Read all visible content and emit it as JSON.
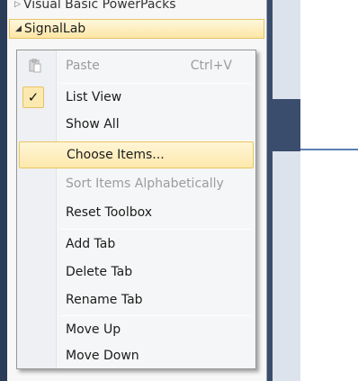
{
  "toolbox": {
    "top_item": "Visual Basic PowerPacks",
    "selected_tab": "SignalLab"
  },
  "menu": {
    "items": [
      {
        "label": "Paste",
        "shortcut": "Ctrl+V",
        "disabled": true,
        "icon": "paste-icon"
      },
      {
        "label": "List View",
        "checked": true
      },
      {
        "label": "Show All"
      },
      {
        "label": "Choose Items...",
        "highlighted": true
      },
      {
        "label": "Sort Items Alphabetically",
        "disabled": true
      },
      {
        "label": "Reset Toolbox"
      },
      {
        "label": "Add Tab"
      },
      {
        "label": "Delete Tab"
      },
      {
        "label": "Rename Tab"
      },
      {
        "label": "Move Up"
      },
      {
        "label": "Move Down"
      }
    ],
    "check_glyph": "✓"
  }
}
